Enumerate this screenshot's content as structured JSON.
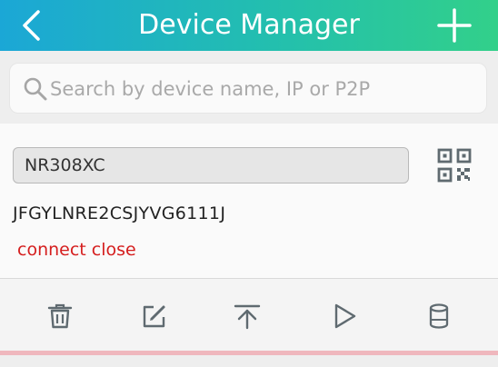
{
  "header": {
    "title": "Device Manager",
    "back_icon": "chevron-left-icon",
    "add_icon": "plus-icon"
  },
  "search": {
    "placeholder": "Search by device name, IP or P2P",
    "value": "",
    "icon": "search-icon"
  },
  "device": {
    "name": "NR308XC",
    "id": "JFGYLNRE2CSJYVG6111J",
    "status": "connect close",
    "qr_icon": "qr-code-icon"
  },
  "actions": [
    {
      "icon": "trash-icon"
    },
    {
      "icon": "edit-icon"
    },
    {
      "icon": "upload-icon"
    },
    {
      "icon": "play-icon"
    },
    {
      "icon": "storage-icon"
    }
  ],
  "colors": {
    "header_start": "#1ba7d6",
    "header_end": "#32d08a",
    "status_red": "#d51e1e",
    "icon_gray": "#5f6a70",
    "accent_line": "#efb7bd"
  }
}
